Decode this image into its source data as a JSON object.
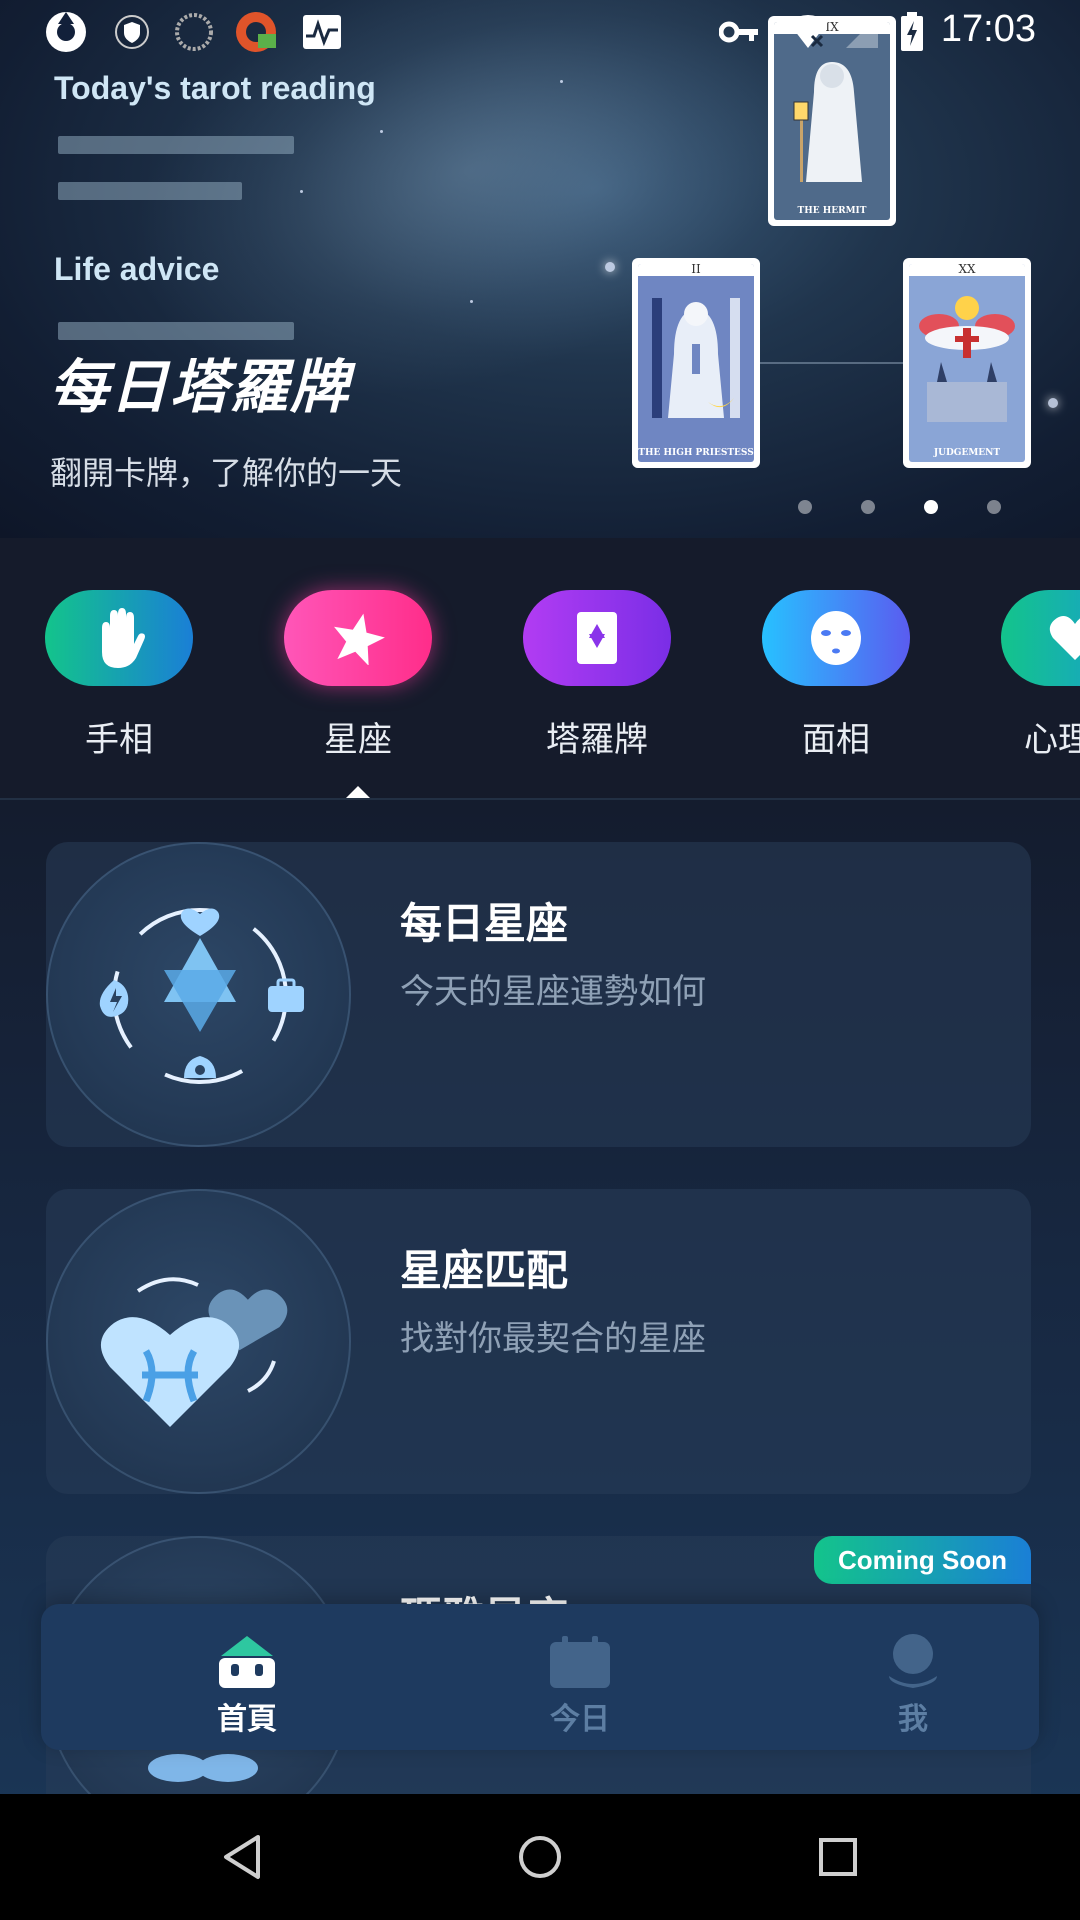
{
  "status_bar": {
    "time": "17:03",
    "left_icons": [
      "aperture-app-icon",
      "shield-vpn-icon",
      "dial-icon",
      "magnet-app-icon",
      "activity-graph-icon"
    ],
    "right_icons": [
      "key-icon",
      "wifi-off-icon",
      "signal-icon",
      "battery-charging-icon"
    ]
  },
  "hero": {
    "reading_label": "Today's tarot reading",
    "advice_label": "Life advice",
    "title": "每日塔羅牌",
    "subtitle": "翻開卡牌，了解你的一天",
    "cards": [
      {
        "numeral": "IX",
        "name": "THE HERMIT"
      },
      {
        "numeral": "II",
        "name": "THE HIGH PRIESTESS"
      },
      {
        "numeral": "XX",
        "name": "JUDGEMENT"
      }
    ],
    "carousel_active_index": 2,
    "carousel_count": 4
  },
  "categories": [
    {
      "label": "手相",
      "icon": "palm-hand-icon",
      "color_from": "#13c48b",
      "color_to": "#1a7fd6"
    },
    {
      "label": "星座",
      "icon": "star-icon",
      "color_from": "#ff4fb6",
      "color_to": "#ff2d8a"
    },
    {
      "label": "塔羅牌",
      "icon": "tarot-card-icon",
      "color_from": "#b23cf3",
      "color_to": "#7a2ee6"
    },
    {
      "label": "面相",
      "icon": "face-mask-icon",
      "color_from": "#27c1ff",
      "color_to": "#5a5cf0"
    },
    {
      "label": "心理測",
      "icon": "heart-icon",
      "color_from": "#13c48b",
      "color_to": "#1a9ad6"
    }
  ],
  "features": [
    {
      "title": "每日星座",
      "description": "今天的星座運勢如何",
      "icon": "hexagram-fortune-icon"
    },
    {
      "title": "星座匹配",
      "description": "找對你最契合的星座",
      "icon": "zodiac-hearts-icon"
    },
    {
      "title": "瑪雅星座",
      "description": "",
      "badge": "Coming Soon",
      "icon": "maya-zodiac-icon"
    }
  ],
  "bottom_nav": {
    "items": [
      {
        "label": "首頁",
        "icon": "home-icon",
        "active": true
      },
      {
        "label": "今日",
        "icon": "calendar-icon",
        "active": false
      },
      {
        "label": "我",
        "icon": "profile-icon",
        "active": false
      }
    ]
  },
  "system_nav": [
    "back-icon",
    "home-circle-icon",
    "recents-icon"
  ],
  "colors": {
    "accent_pink": "#ff3ea5",
    "nav_active": "#ffffff",
    "nav_inactive": "#5d7ea3",
    "coming_soon_from": "#13c48b",
    "coming_soon_to": "#1a7fd6"
  }
}
